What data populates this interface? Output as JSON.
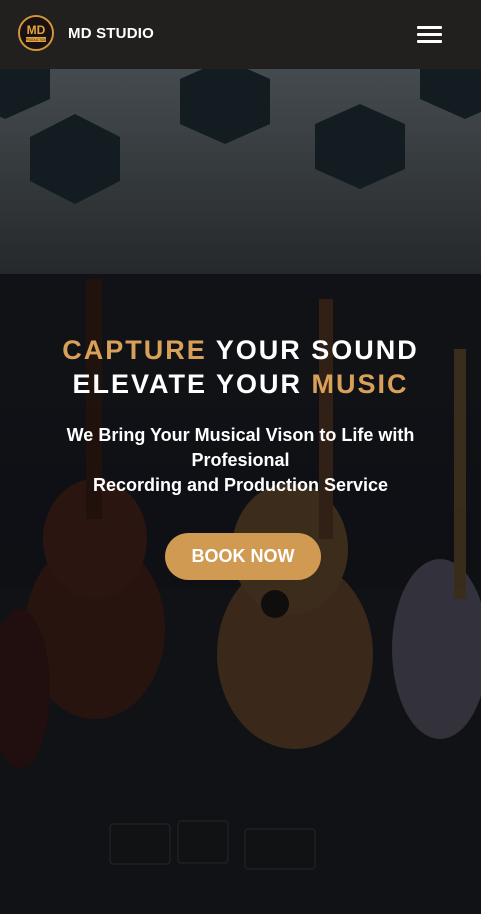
{
  "brand": {
    "name": "MD STUDIO",
    "logo_text": "MD",
    "logo_subtext": "PRODUCTION"
  },
  "nav": {
    "menu_icon": "hamburger-menu-icon"
  },
  "hero": {
    "headline_line1_accent": "CAPTURE",
    "headline_line1_rest": " YOUR SOUND",
    "headline_line2_rest": "ELEVATE YOUR ",
    "headline_line2_accent": "MUSIC",
    "subtitle_line1": "We Bring Your Musical Vison to Life with Profesional",
    "subtitle_line2": "Recording and Production Service",
    "cta_label": "BOOK NOW"
  },
  "colors": {
    "navbar": "#221f1f",
    "accent": "#d9a05a",
    "button": "#d09a52",
    "text": "#ffffff"
  }
}
